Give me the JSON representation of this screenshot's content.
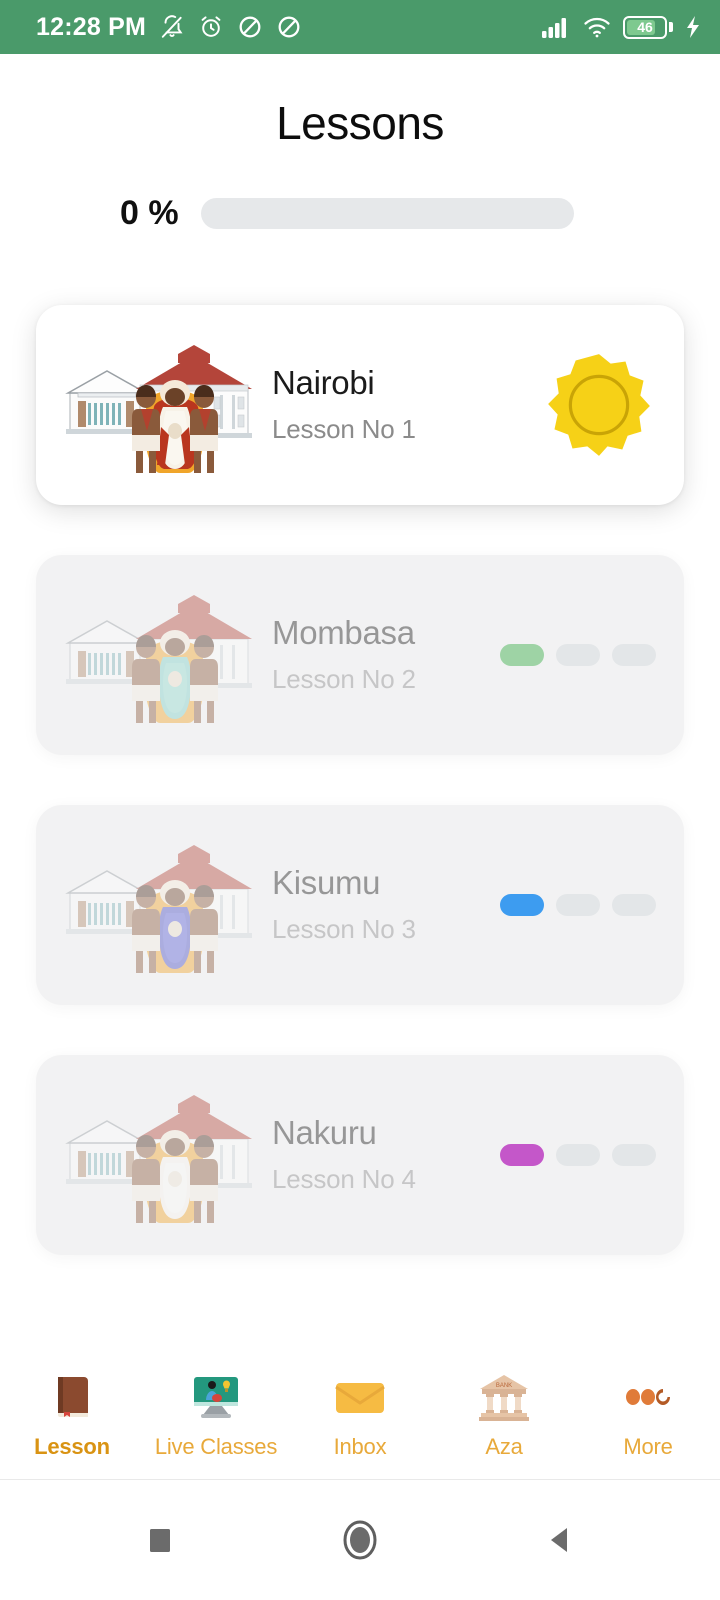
{
  "statusbar": {
    "time": "12:28 PM",
    "battery_level": "46",
    "left_icons": [
      "bell-off-icon",
      "alarm-icon",
      "do-not-disturb-icon",
      "do-not-disturb-icon"
    ],
    "right_icons": [
      "cellular-signal-icon",
      "wifi-icon",
      "battery-icon",
      "charging-bolt-icon"
    ]
  },
  "header": {
    "title": "Lessons"
  },
  "progress": {
    "percent_label": "0 %",
    "percent_value": 0
  },
  "lessons": [
    {
      "title": "Nairobi",
      "subtitle": "Lesson No 1",
      "state": "active",
      "badge": "sun-badge",
      "badge_color": "#F6D117"
    },
    {
      "title": "Mombasa",
      "subtitle": "Lesson No 2",
      "state": "locked",
      "pill_color": "#9ed3a5",
      "pills_total": 3,
      "pills_filled": 1
    },
    {
      "title": "Kisumu",
      "subtitle": "Lesson No 3",
      "state": "locked",
      "pill_color": "#3d9cf0",
      "pills_total": 3,
      "pills_filled": 1
    },
    {
      "title": "Nakuru",
      "subtitle": "Lesson No 4",
      "state": "locked",
      "pill_color": "#c457c9",
      "pills_total": 3,
      "pills_filled": 1
    }
  ],
  "bottom_nav": {
    "active_index": 0,
    "items": [
      {
        "label": "Lesson",
        "icon": "book-icon"
      },
      {
        "label": "Live Classes",
        "icon": "monitor-teacher-icon"
      },
      {
        "label": "Inbox",
        "icon": "envelope-icon"
      },
      {
        "label": "Aza",
        "icon": "bank-icon",
        "icon_text": "BANK"
      },
      {
        "label": "More",
        "icon": "three-dots-icon"
      }
    ]
  },
  "android_nav": {
    "buttons": [
      {
        "name": "recents-button",
        "icon": "square-icon"
      },
      {
        "name": "home-button",
        "icon": "circle-icon"
      },
      {
        "name": "back-button",
        "icon": "triangle-left-icon"
      }
    ]
  },
  "colors": {
    "status_bar": "#4a9a6a",
    "nav_accent": "#e8a93a",
    "nav_accent_active": "#d99313",
    "track": "#e6e8ea"
  }
}
